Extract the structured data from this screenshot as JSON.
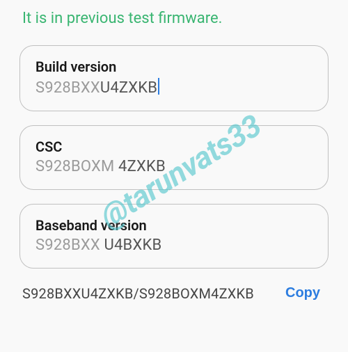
{
  "header": "It is in previous test firmware.",
  "fields": {
    "build": {
      "label": "Build version",
      "prefix": "S928BXX",
      "value": "U4ZXKB",
      "has_cursor": true
    },
    "csc": {
      "label": "CSC",
      "prefix": "S928BOXM",
      "value": "4ZXKB",
      "has_cursor": false
    },
    "baseband": {
      "label": "Baseband version",
      "prefix": "S928BXX",
      "value": "U4BXKB",
      "has_cursor": false
    }
  },
  "summary": "S928BXXU4ZXKB/S928BOXM4ZXKB",
  "copy_label": "Copy",
  "watermark": "@tarunvats33"
}
